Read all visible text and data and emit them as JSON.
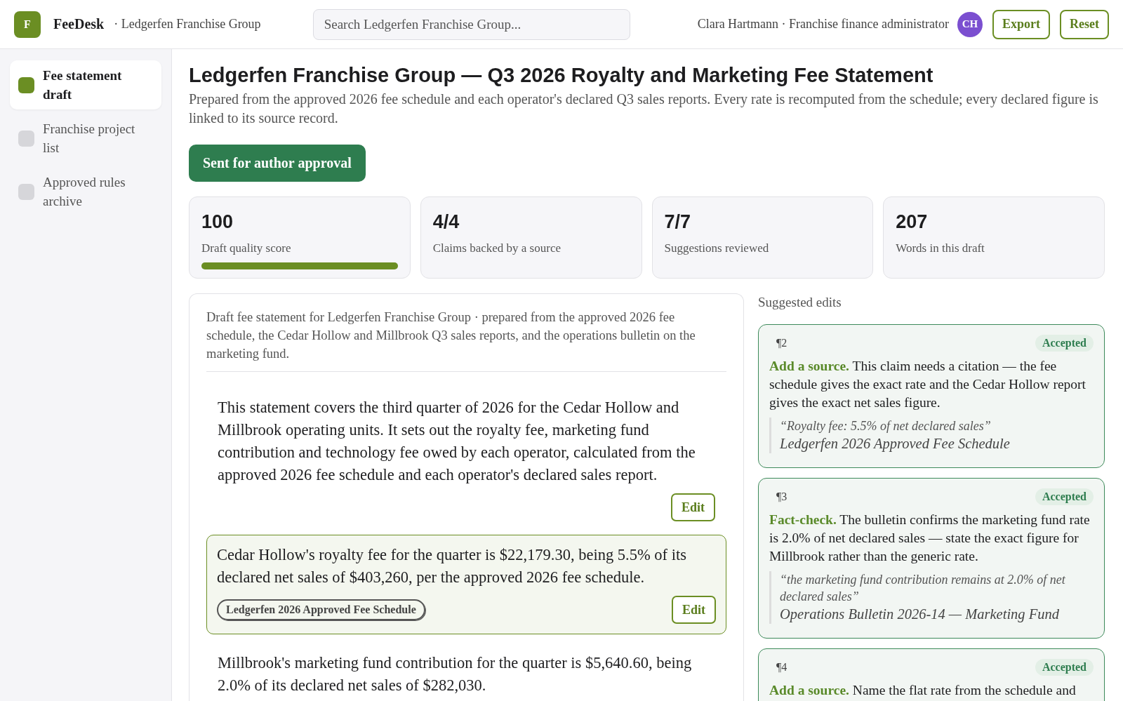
{
  "topbar": {
    "logo": "F",
    "app": "FeeDesk",
    "workspace": "· Ledgerfen Franchise Group",
    "search": {
      "placeholder": "Search Ledgerfen Franchise Group..."
    },
    "user": "Clara Hartmann · Franchise finance administrator",
    "avatar": "CH",
    "buttons": [
      "Export",
      "Reset"
    ]
  },
  "sidebar": {
    "items": [
      {
        "label": "Fee statement draft",
        "selected": true
      },
      {
        "label": "Franchise project list",
        "selected": false
      },
      {
        "label": "Approved rules archive",
        "selected": false
      }
    ]
  },
  "title": "Ledgerfen Franchise Group — Q3 2026 Royalty and Marketing Fee Statement",
  "subtitle": "Prepared from the approved 2026 fee schedule and each operator's declared Q3 sales reports. Every rate is recomputed from the schedule; every declared figure is linked to its source record.",
  "status_button": "Sent for author approval",
  "stats": [
    {
      "value": "100",
      "label": "Draft quality score",
      "level": 1
    },
    {
      "value": "4/4",
      "label": "Claims backed by a source"
    },
    {
      "value": "7/7",
      "label": "Suggestions reviewed"
    },
    {
      "value": "207",
      "label": "Words in this draft"
    }
  ],
  "document": {
    "intro": "Draft fee statement for Ledgerfen Franchise Group · prepared from the approved 2026 fee schedule, the Cedar Hollow and Millbrook Q3 sales reports, and the operations bulletin on the marketing fund.",
    "paragraphs": [
      {
        "text": "This statement covers the third quarter of 2026 for the Cedar Hollow and Millbrook operating units. It sets out the royalty fee, marketing fund contribution and technology fee owed by each operator, calculated from the approved 2026 fee schedule and each operator's declared sales report.",
        "selected": false,
        "edit": "Edit"
      },
      {
        "text": "Cedar Hollow's royalty fee for the quarter is $22,179.30, being 5.5% of its declared net sales of $403,260, per the approved 2026 fee schedule.",
        "selected": true,
        "source": "Ledgerfen 2026 Approved Fee Schedule",
        "edit": "Edit"
      },
      {
        "text": "Millbrook's marketing fund contribution for the quarter is $5,640.60, being 2.0% of its declared net sales of $282,030.",
        "selected": false
      }
    ]
  },
  "suggestions": {
    "title": "Suggested edits",
    "items": [
      {
        "para": "¶2",
        "status": "Accepted",
        "text": "**Add a source.** This claim needs a citation — the fee schedule gives the exact rate and the Cedar Hollow report gives the exact net sales figure.",
        "quote": "“Royalty fee: 5.5% of net declared sales”",
        "source": "Ledgerfen 2026 Approved Fee Schedule"
      },
      {
        "para": "¶3",
        "status": "Accepted",
        "text": "**Fact-check.** The bulletin confirms the marketing fund rate is 2.0% of net declared sales — state the exact figure for Millbrook rather than the generic rate.",
        "quote": "“the marketing fund contribution remains at 2.0% of net declared sales”",
        "source": "Operations Bulletin 2026-14 — Marketing Fund"
      },
      {
        "para": "¶4",
        "status": "Accepted",
        "text": "**Add a source.** Name the flat rate from the schedule and"
      }
    ]
  }
}
